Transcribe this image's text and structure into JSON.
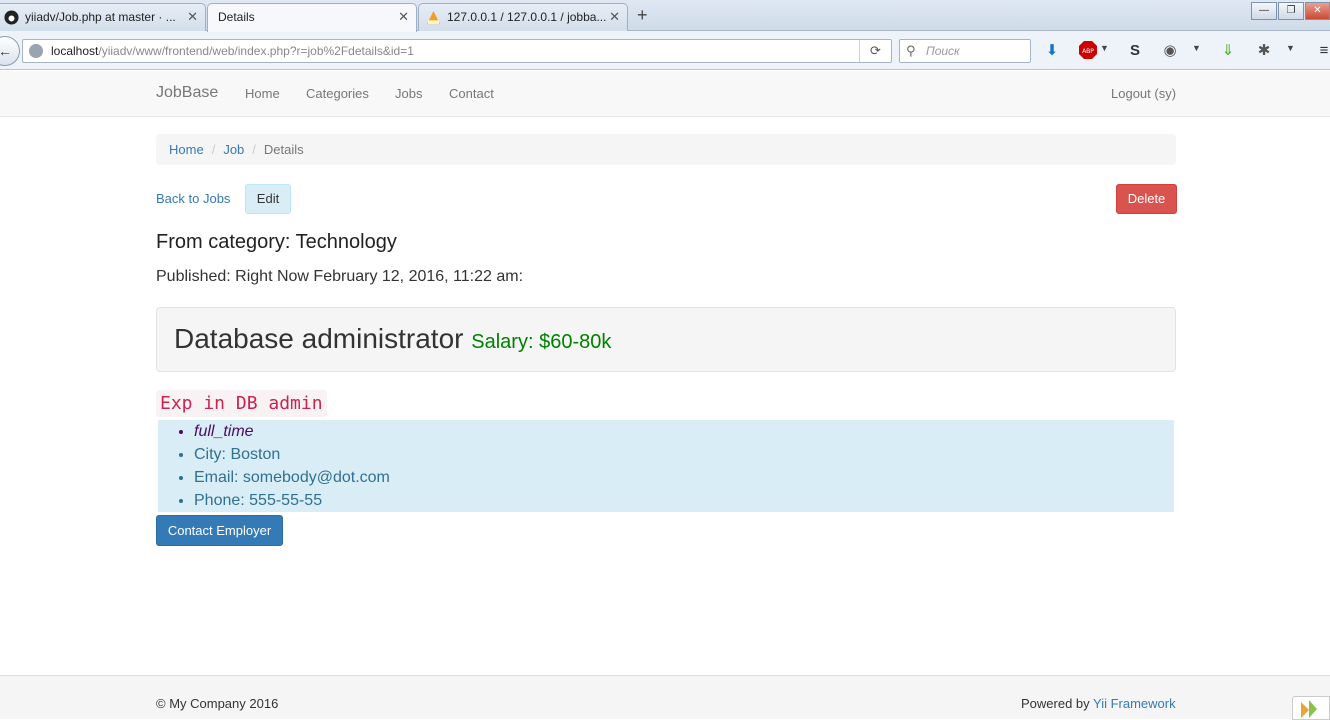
{
  "browser": {
    "tabs": [
      {
        "label": "yiiadv/Job.php at master · ...",
        "active": false
      },
      {
        "label": "Details",
        "active": true
      },
      {
        "label": "127.0.0.1 / 127.0.0.1 / jobba...",
        "active": false
      }
    ],
    "new_tab": "+",
    "url": {
      "host": "localhost",
      "path": "/yiiadv/www/frontend/web/index.php?r=job%2Fdetails&id=1"
    },
    "search_placeholder": "Поиск",
    "window_controls": {
      "minimize": "—",
      "maximize": "❐",
      "close": "✕"
    }
  },
  "site": {
    "brand": "JobBase",
    "nav": [
      "Home",
      "Categories",
      "Jobs",
      "Contact"
    ],
    "logout": "Logout (sy)"
  },
  "breadcrumb": {
    "items": [
      "Home",
      "Job"
    ],
    "active": "Details"
  },
  "actions": {
    "back": "Back to Jobs",
    "edit": "Edit",
    "delete": "Delete"
  },
  "job": {
    "category_heading": "From category: Technology",
    "published": "Published: Right Now February 12, 2016, 11:22 am:",
    "title": "Database administrator",
    "salary": "Salary: $60-80k",
    "description": "Exp in DB admin",
    "type": "full_time",
    "city": "City: Boston",
    "email": "Email: somebody@dot.com",
    "phone": "Phone: 555-55-55",
    "contact_button": "Contact Employer"
  },
  "footer": {
    "copyright": "© My Company 2016",
    "powered_by": "Powered by ",
    "framework": "Yii Framework"
  },
  "colors": {
    "primary": "#337ab7",
    "danger": "#d9534f",
    "info_bg": "#d9edf7",
    "salary": "#008000",
    "code": "#c7254e"
  }
}
